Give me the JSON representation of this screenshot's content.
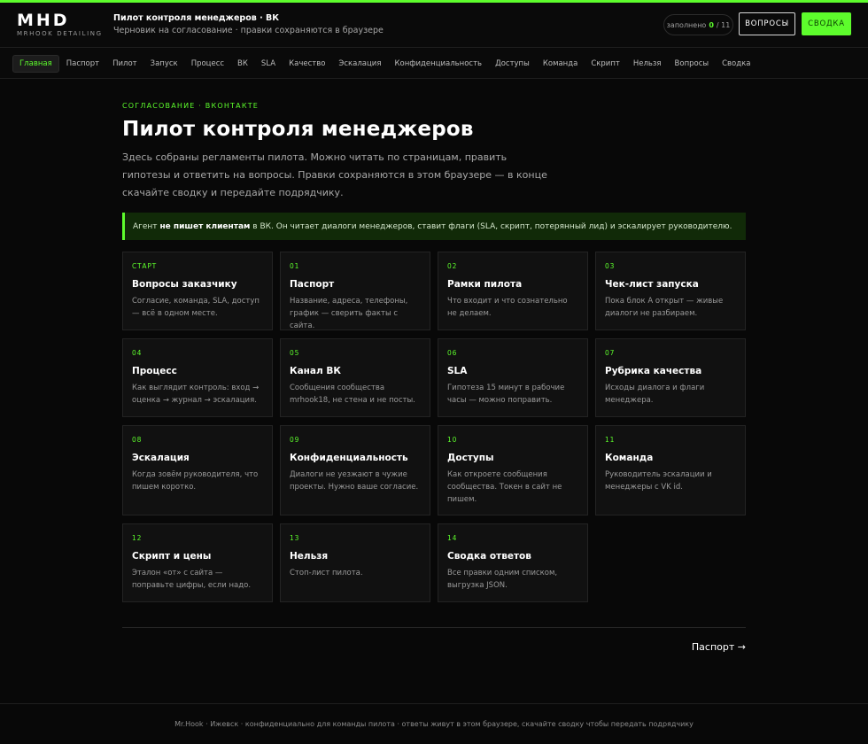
{
  "header": {
    "logo": "MHD",
    "logo_sub": "MRHOOK DETAILING",
    "title": "Пилот контроля менеджеров · ВК",
    "subtitle": "Черновик на согласование · правки сохраняются в браузере",
    "counter_label": "заполнено",
    "counter_filled": "0",
    "counter_total": "/ 11",
    "questions_button": "ВОПРОСЫ",
    "summary_button": "СВОДКА"
  },
  "nav": {
    "items": [
      "Главная",
      "Паспорт",
      "Пилот",
      "Запуск",
      "Процесс",
      "ВК",
      "SLA",
      "Качество",
      "Эскалация",
      "Конфиденциальность",
      "Доступы",
      "Команда",
      "Скрипт",
      "Нельзя",
      "Вопросы",
      "Сводка"
    ],
    "active_index": 0
  },
  "main": {
    "eyebrow": "СОГЛАСОВАНИЕ · ВКОНТАКТЕ",
    "title": "Пилот контроля менеджеров",
    "intro": "Здесь собраны регламенты пилота. Можно читать по страницам, править гипотезы и ответить на вопросы. Правки сохраняются в этом браузере — в конце скачайте сводку и передайте подрядчику.",
    "notice_prefix": "Агент",
    "notice_bold": "не пишет клиентам",
    "notice_suffix": "в ВК. Он читает диалоги менеджеров, ставит флаги (SLA, скрипт, потерянный лид) и эскалирует руководителю."
  },
  "cards": [
    {
      "num": "СТАРТ",
      "title": "Вопросы заказчику",
      "desc": "Согласие, команда, SLA, доступ — всё в одном месте."
    },
    {
      "num": "01",
      "title": "Паспорт",
      "desc": "Название, адреса, телефоны, график — сверить факты с сайта."
    },
    {
      "num": "02",
      "title": "Рамки пилота",
      "desc": "Что входит и что сознательно не делаем."
    },
    {
      "num": "03",
      "title": "Чек-лист запуска",
      "desc": "Пока блок А открыт — живые диалоги не разбираем."
    },
    {
      "num": "04",
      "title": "Процесс",
      "desc": "Как выглядит контроль: вход → оценка → журнал → эскалация."
    },
    {
      "num": "05",
      "title": "Канал ВК",
      "desc": "Сообщения сообщества mrhook18, не стена и не посты."
    },
    {
      "num": "06",
      "title": "SLA",
      "desc": "Гипотеза 15 минут в рабочие часы — можно поправить."
    },
    {
      "num": "07",
      "title": "Рубрика качества",
      "desc": "Исходы диалога и флаги менеджера."
    },
    {
      "num": "08",
      "title": "Эскалация",
      "desc": "Когда зовём руководителя, что пишем коротко."
    },
    {
      "num": "09",
      "title": "Конфиденциальность",
      "desc": "Диалоги не уезжают в чужие проекты. Нужно ваше согласие."
    },
    {
      "num": "10",
      "title": "Доступы",
      "desc": "Как откроете сообщения сообщества. Токен в сайт не пишем."
    },
    {
      "num": "11",
      "title": "Команда",
      "desc": "Руководитель эскалации и менеджеры с VK id."
    },
    {
      "num": "12",
      "title": "Скрипт и цены",
      "desc": "Эталон «от» с сайта — поправьте цифры, если надо."
    },
    {
      "num": "13",
      "title": "Нельзя",
      "desc": "Стоп-лист пилота."
    },
    {
      "num": "14",
      "title": "Сводка ответов",
      "desc": "Все правки одним списком, выгрузка JSON."
    }
  ],
  "next_link": "Паспорт →",
  "footer": "Mr.Hook · Ижевск · конфиденциально для команды пилота · ответы живут в этом браузере, скачайте сводку чтобы передать подрядчику",
  "colors": {
    "accent": "#5dfc2c",
    "background": "#080808",
    "card": "#111111",
    "notice_bg": "#112a08"
  }
}
